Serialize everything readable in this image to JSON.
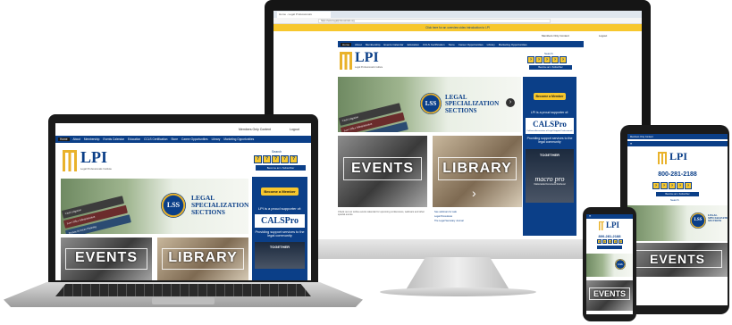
{
  "browser": {
    "tab_title": "Home - Legal Professionals",
    "address": "https://www.legalprofessionals.org",
    "banner": "Click here for an overview video introduction to LPI"
  },
  "header": {
    "members_only": "Members Only Content",
    "logout": "Logout",
    "search_label": "Search"
  },
  "nav": {
    "items": [
      "Home",
      "About",
      "Membership",
      "Events Calendar",
      "Education",
      "CCLS Certification",
      "Store",
      "Career Opportunities",
      "Library",
      "Marketing Opportunities"
    ]
  },
  "logo": {
    "text": "LPI",
    "tagline": "Legal Professionals Institute"
  },
  "hero": {
    "books": [
      "Civil Litigation",
      "Law Office Administration",
      "Criminal Legal Guide",
      "Probate & Estate Planning"
    ],
    "badge": "LSS",
    "title": "LEGAL SPECIALIZATION SECTIONS"
  },
  "sidebar": {
    "become_member": "Become a Member",
    "proud_supporter": "LPI is a proud supporter of:",
    "cals_title": "CALSPro",
    "cals_sub": "California Association of Legal Support Professionals",
    "support_text": "Providing support services to the legal community",
    "together": "TOGETHER",
    "macro": "macro pro",
    "macro_sub": "Nationwide Document Retrieval"
  },
  "cards": {
    "events": "EVENTS",
    "library": "LIBRARY"
  },
  "content": {
    "intro": "Check out our online events calendar for upcoming conferences, webinars and other special events.",
    "links": [
      "See webinars for sale",
      "Legal Procedures",
      "The Legal Secretary Journal"
    ],
    "phone": "800-281-2188",
    "become_lss": "Become an L Subscriber"
  },
  "colors": {
    "brand_blue": "#0b3f88",
    "gold": "#f7c72d"
  }
}
